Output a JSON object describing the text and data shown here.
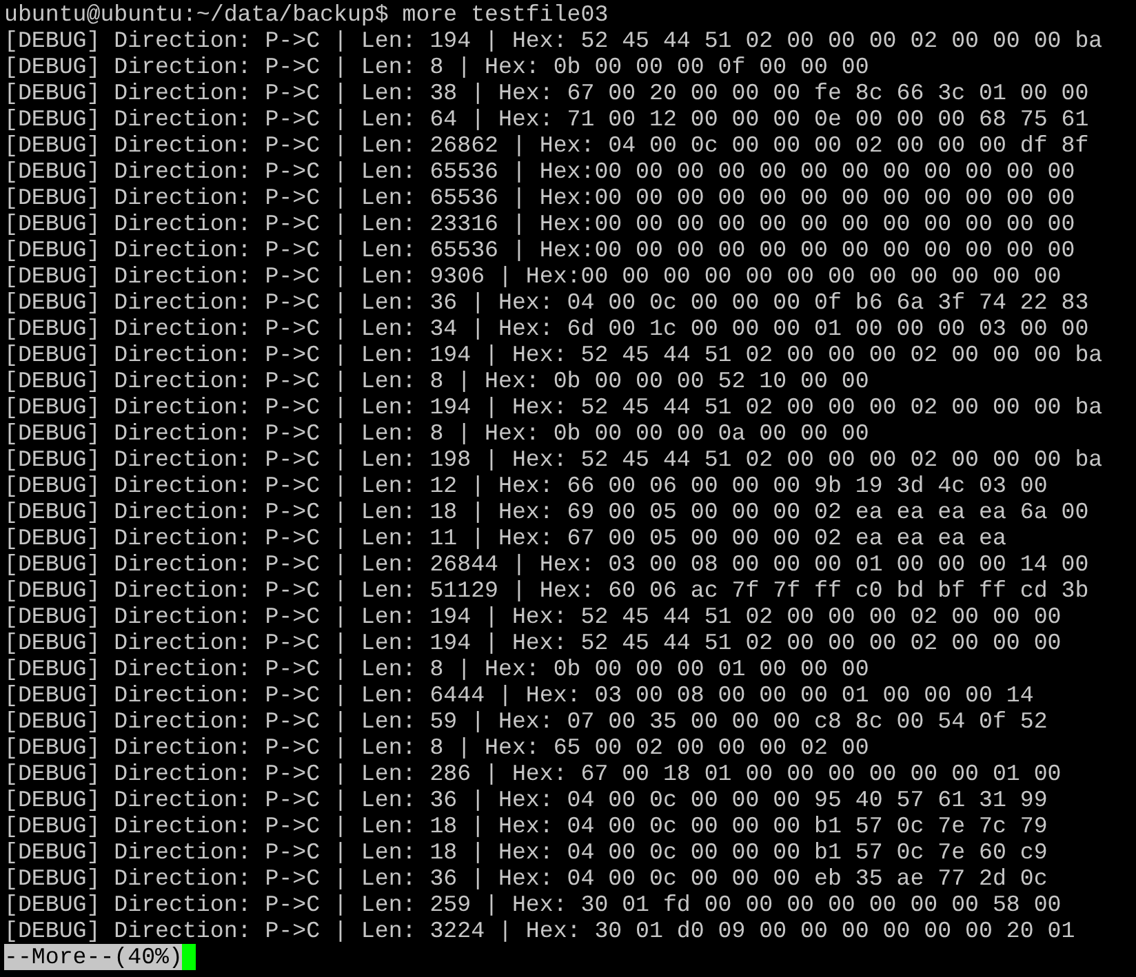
{
  "terminal": {
    "prompt": "ubuntu@ubuntu:~/data/backup$ more testfile03",
    "lines": [
      "[DEBUG] Direction: P->C | Len: 194 | Hex: 52 45 44 51 02 00 00 00 02 00 00 00 ba",
      "[DEBUG] Direction: P->C | Len: 8 | Hex: 0b 00 00 00 0f 00 00 00",
      "[DEBUG] Direction: P->C | Len: 38 | Hex: 67 00 20 00 00 00 fe 8c 66 3c 01 00 00",
      "[DEBUG] Direction: P->C | Len: 64 | Hex: 71 00 12 00 00 00 0e 00 00 00 68 75 61",
      "[DEBUG] Direction: P->C | Len: 26862 | Hex: 04 00 0c 00 00 00 02 00 00 00 df 8f",
      "[DEBUG] Direction: P->C | Len: 65536 | Hex:00 00 00 00 00 00 00 00 00 00 00 00",
      "[DEBUG] Direction: P->C | Len: 65536 | Hex:00 00 00 00 00 00 00 00 00 00 00 00",
      "[DEBUG] Direction: P->C | Len: 23316 | Hex:00 00 00 00 00 00 00 00 00 00 00 00",
      "[DEBUG] Direction: P->C | Len: 65536 | Hex:00 00 00 00 00 00 00 00 00 00 00 00",
      "[DEBUG] Direction: P->C | Len: 9306 | Hex:00 00 00 00 00 00 00 00 00 00 00 00",
      "[DEBUG] Direction: P->C | Len: 36 | Hex: 04 00 0c 00 00 00 0f b6 6a 3f 74 22 83",
      "[DEBUG] Direction: P->C | Len: 34 | Hex: 6d 00 1c 00 00 00 01 00 00 00 03 00 00",
      "[DEBUG] Direction: P->C | Len: 194 | Hex: 52 45 44 51 02 00 00 00 02 00 00 00 ba",
      "[DEBUG] Direction: P->C | Len: 8 | Hex: 0b 00 00 00 52 10 00 00",
      "[DEBUG] Direction: P->C | Len: 194 | Hex: 52 45 44 51 02 00 00 00 02 00 00 00 ba",
      "[DEBUG] Direction: P->C | Len: 8 | Hex: 0b 00 00 00 0a 00 00 00",
      "[DEBUG] Direction: P->C | Len: 198 | Hex: 52 45 44 51 02 00 00 00 02 00 00 00 ba",
      "[DEBUG] Direction: P->C | Len: 12 | Hex: 66 00 06 00 00 00 9b 19 3d 4c 03 00",
      "[DEBUG] Direction: P->C | Len: 18 | Hex: 69 00 05 00 00 00 02 ea ea ea ea 6a 00",
      "[DEBUG] Direction: P->C | Len: 11 | Hex: 67 00 05 00 00 00 02 ea ea ea ea",
      "[DEBUG] Direction: P->C | Len: 26844 | Hex: 03 00 08 00 00 00 01 00 00 00 14 00",
      "[DEBUG] Direction: P->C | Len: 51129 | Hex: 60 06 ac 7f 7f ff c0 bd bf ff cd 3b",
      "[DEBUG] Direction: P->C | Len: 194 | Hex: 52 45 44 51 02 00 00 00 02 00 00 00",
      "[DEBUG] Direction: P->C | Len: 194 | Hex: 52 45 44 51 02 00 00 00 02 00 00 00",
      "[DEBUG] Direction: P->C | Len: 8 | Hex: 0b 00 00 00 01 00 00 00",
      "[DEBUG] Direction: P->C | Len: 6444 | Hex: 03 00 08 00 00 00 01 00 00 00 14",
      "[DEBUG] Direction: P->C | Len: 59 | Hex: 07 00 35 00 00 00 c8 8c 00 54 0f 52",
      "[DEBUG] Direction: P->C | Len: 8 | Hex: 65 00 02 00 00 00 02 00",
      "[DEBUG] Direction: P->C | Len: 286 | Hex: 67 00 18 01 00 00 00 00 00 00 01 00",
      "[DEBUG] Direction: P->C | Len: 36 | Hex: 04 00 0c 00 00 00 95 40 57 61 31 99",
      "[DEBUG] Direction: P->C | Len: 18 | Hex: 04 00 0c 00 00 00 b1 57 0c 7e 7c 79",
      "[DEBUG] Direction: P->C | Len: 18 | Hex: 04 00 0c 00 00 00 b1 57 0c 7e 60 c9",
      "[DEBUG] Direction: P->C | Len: 36 | Hex: 04 00 0c 00 00 00 eb 35 ae 77 2d 0c",
      "[DEBUG] Direction: P->C | Len: 259 | Hex: 30 01 fd 00 00 00 00 00 00 00 58 00",
      "[DEBUG] Direction: P->C | Len: 3224 | Hex: 30 01 d0 09 00 00 00 00 00 00 20 01"
    ],
    "pager_status": "--More--(40%)"
  }
}
